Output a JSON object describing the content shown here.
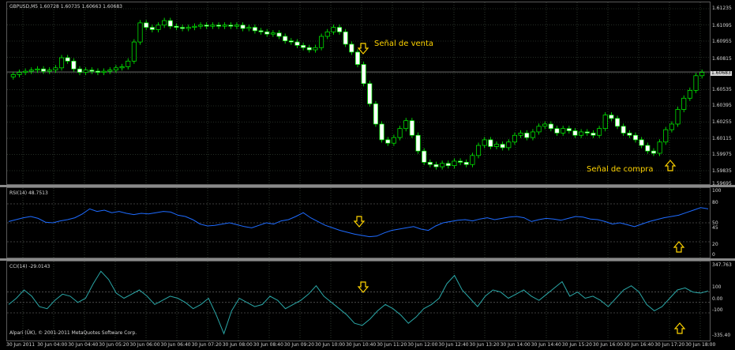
{
  "main_chart": {
    "symbol_label": "GBPUSD,M5  1.60728 1.60735 1.60663 1.60683",
    "price_ticks": [
      "1.61235",
      "1.61095",
      "1.60955",
      "1.60815",
      "1.60683",
      "1.60535",
      "1.60395",
      "1.60255",
      "1.60115",
      "1.59975",
      "1.59835",
      "1.59695"
    ],
    "current_price": "1.60683",
    "sell_signal": "Señal de venta",
    "buy_signal": "Señal de compra"
  },
  "rsi": {
    "label": "RSI(14) 48.7513",
    "ticks": [
      "100",
      "80",
      "50",
      "45",
      "20",
      "0"
    ]
  },
  "cci": {
    "label": "CCI(14) -29.0143",
    "ticks": [
      "347.763",
      "100",
      "0.00",
      "-100",
      "-335.40"
    ],
    "copyright": "Alpari (ÜK), © 2001-2011 MetaQuotes Software Corp."
  },
  "time_axis": [
    "30 Jun 2011",
    "30 Jun 04:00",
    "30 Jun 04:40",
    "30 Jun 05:20",
    "30 Jun 06:00",
    "30 Jun 06:40",
    "30 Jun 07:20",
    "30 Jun 08:00",
    "30 Jun 08:40",
    "30 Jun 09:20",
    "30 Jun 10:00",
    "30 Jun 10:40",
    "30 Jun 11:20",
    "30 Jun 12:00",
    "30 Jun 12:40",
    "30 Jun 13:20",
    "30 Jun 14:00",
    "30 Jun 14:40",
    "30 Jun 15:20",
    "30 Jun 16:00",
    "30 Jun 16:40",
    "30 Jun 17:20",
    "30 Jun 18:00"
  ],
  "colors": {
    "candle": "#00ff00",
    "rsi_line": "#1e6bff",
    "cci_line": "#2aa7a7",
    "annotation": "#ffd400",
    "grid": "#4a5a4a"
  },
  "chart_data": {
    "type": "line",
    "series": [
      {
        "values": [
          1.6066,
          1.6068,
          1.6069,
          1.607,
          1.6071,
          1.6069,
          1.607,
          1.6072,
          1.6081,
          1.6078,
          1.6071,
          1.6068,
          1.607,
          1.6069,
          1.6068,
          1.6069,
          1.607,
          1.6072,
          1.6073,
          1.6078,
          1.6095,
          1.6112,
          1.6108,
          1.6106,
          1.611,
          1.6114,
          1.6109,
          1.6108,
          1.6107,
          1.6108,
          1.6109,
          1.611,
          1.6109,
          1.611,
          1.6109,
          1.611,
          1.6109,
          1.611,
          1.6107,
          1.6108,
          1.6105,
          1.6104,
          1.6102,
          1.6103,
          1.61,
          1.6096,
          1.6095,
          1.6092,
          1.609,
          1.6088,
          1.609,
          1.61,
          1.6104,
          1.6108,
          1.6104,
          1.6093,
          1.6086,
          1.6075,
          1.6058,
          1.604,
          1.6022,
          1.6008,
          1.6005,
          1.601,
          1.6018,
          1.6025,
          1.6012,
          1.5998,
          1.5988,
          1.5986,
          1.5984,
          1.5987,
          1.5985,
          1.5989,
          1.5988,
          1.5986,
          1.5994,
          1.6003,
          1.6008,
          1.6002,
          1.6004,
          1.6001,
          1.6006,
          1.6012,
          1.6014,
          1.601,
          1.6015,
          1.602,
          1.6022,
          1.6018,
          1.6014,
          1.6018,
          1.6016,
          1.6012,
          1.6015,
          1.6014,
          1.6012,
          1.6018,
          1.603,
          1.6027,
          1.602,
          1.6014,
          1.6012,
          1.6008,
          1.6003,
          1.5998,
          1.5996,
          1.6006,
          1.6017,
          1.6022,
          1.6035,
          1.6045,
          1.6052,
          1.6065,
          1.6068
        ]
      }
    ]
  }
}
